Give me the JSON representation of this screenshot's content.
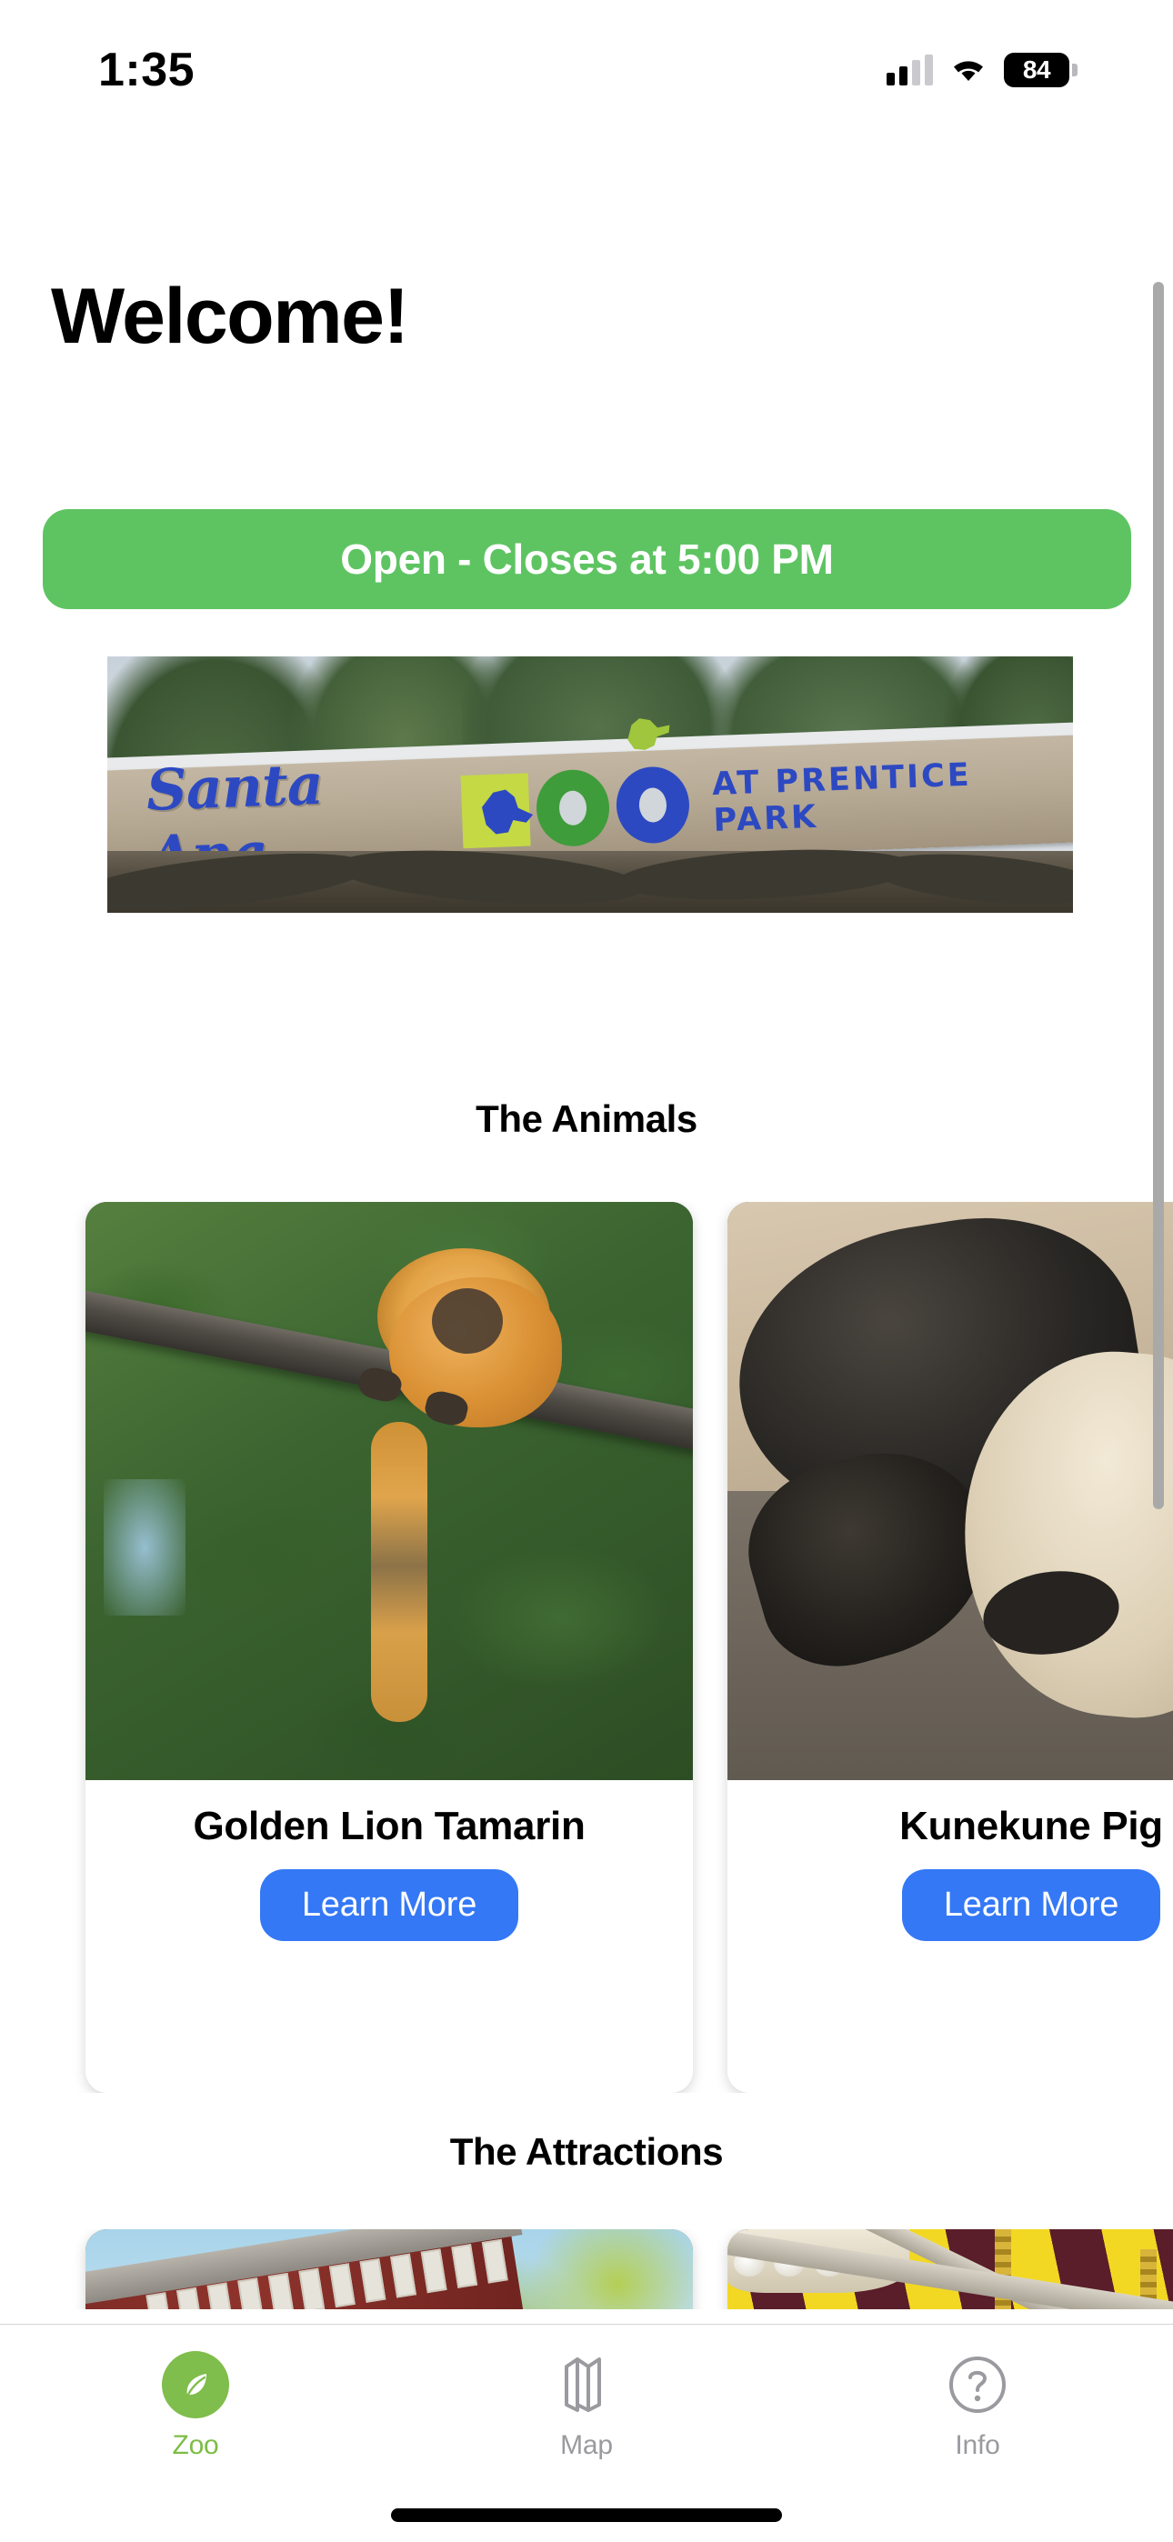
{
  "status_bar": {
    "time": "1:35",
    "signal_icon": "cellular-signal-icon",
    "wifi_icon": "wifi-icon",
    "battery_percent": "84",
    "battery_icon": "battery-icon"
  },
  "screen": {
    "title": "Welcome!"
  },
  "hours_banner": {
    "text": "Open - Closes at 5:00 PM",
    "color": "#5ec462"
  },
  "hero": {
    "image_name": "santa-ana-zoo-entrance-sign",
    "sign_primary": "Santa Ana",
    "sign_zoo": "ZOO",
    "sign_secondary": "AT PRENTICE PARK",
    "blue": "#2d49c2",
    "chartreuse": "#c4d944",
    "green": "#3f9c3a"
  },
  "sections": [
    {
      "heading": "The Animals",
      "cards": [
        {
          "title": "Golden Lion Tamarin",
          "button_label": "Learn More",
          "image_name": "golden-lion-tamarin-photo"
        },
        {
          "title": "Kunekune Pig",
          "button_label": "Learn More",
          "image_name": "kunekune-pig-photo"
        }
      ]
    },
    {
      "heading": "The Attractions",
      "cards": [
        {
          "image_name": "zoofari-express-train-station-photo"
        },
        {
          "image_name": "conservation-carousel-photo"
        }
      ]
    }
  ],
  "tab_bar": {
    "items": [
      {
        "label": "Zoo",
        "icon": "leaf-icon",
        "active": true
      },
      {
        "label": "Map",
        "icon": "map-icon",
        "active": false
      },
      {
        "label": "Info",
        "icon": "question-mark-circle-icon",
        "active": false
      }
    ],
    "active_color": "#7dbd45",
    "inactive_color": "#9a9a9f"
  },
  "accent_colors": {
    "button_blue": "#3478f6",
    "banner_green": "#5ec462",
    "tab_green": "#7fbd4c"
  }
}
